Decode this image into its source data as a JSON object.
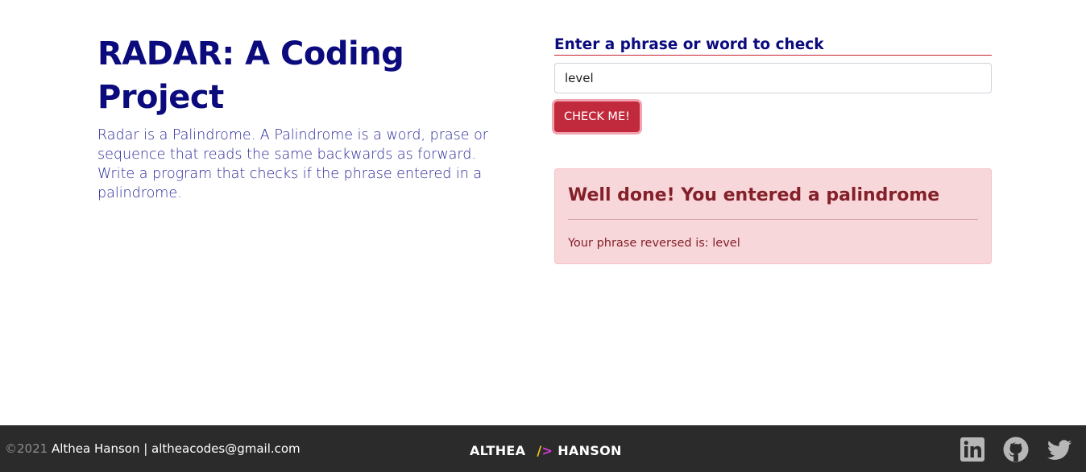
{
  "hero": {
    "title": "RADAR: A Coding Project",
    "description": "Radar is a Palindrome. A Palindrome is a word, prase or sequence that reads the same backwards as forward. Write a program that checks if the phrase entered in a palindrome."
  },
  "form": {
    "label": "Enter a phrase or word to check",
    "input_value": "level",
    "button_label": "CHECK ME!"
  },
  "result": {
    "heading": "Well done! You entered a palindrome",
    "text": "Your phrase reversed is: level"
  },
  "footer": {
    "copyright_year": "©2021",
    "author_contact": "Althea Hanson | altheacodes@gmail.com",
    "brand_first": "ALTHEA",
    "brand_slash": "/",
    "brand_gt": ">",
    "brand_last": "HANSON",
    "social_icons": [
      "linkedin-icon",
      "github-icon",
      "twitter-icon"
    ]
  },
  "colors": {
    "primary_text": "#0b0b7e",
    "button": "#c12a3c",
    "alert_bg": "#f8d7da",
    "alert_text": "#842029",
    "footer_bg": "#2b2b2b",
    "icon_gray": "#b7b7b7"
  }
}
